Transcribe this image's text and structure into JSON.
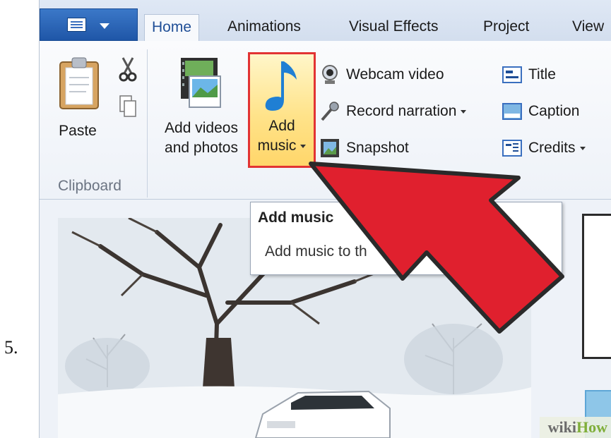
{
  "step_number": "5.",
  "tabs": [
    {
      "label": "Home",
      "active": true
    },
    {
      "label": "Animations"
    },
    {
      "label": "Visual Effects"
    },
    {
      "label": "Project"
    },
    {
      "label": "View"
    }
  ],
  "clipboard": {
    "paste_label": "Paste",
    "group_label": "Clipboard"
  },
  "add_group": {
    "add_videos_line1": "Add videos",
    "add_videos_line2": "and photos",
    "add_music_line1": "Add",
    "add_music_line2": "music"
  },
  "media_items": [
    {
      "label": "Webcam video",
      "icon": "webcam-icon"
    },
    {
      "label": "Record narration",
      "icon": "microphone-icon",
      "dropdown": true
    },
    {
      "label": "Snapshot",
      "icon": "snapshot-icon"
    }
  ],
  "text_items": [
    {
      "label": "Title",
      "icon": "title-icon"
    },
    {
      "label": "Caption",
      "icon": "caption-icon"
    },
    {
      "label": "Credits",
      "icon": "credits-icon",
      "dropdown": true
    }
  ],
  "tooltip": {
    "title": "Add music",
    "body": "Add music to th"
  },
  "watermark": {
    "left": "wiki",
    "right": "How"
  },
  "colors": {
    "highlight_border": "#e23333",
    "arrow_fill": "#e0202e",
    "accent": "#1f56a7"
  }
}
